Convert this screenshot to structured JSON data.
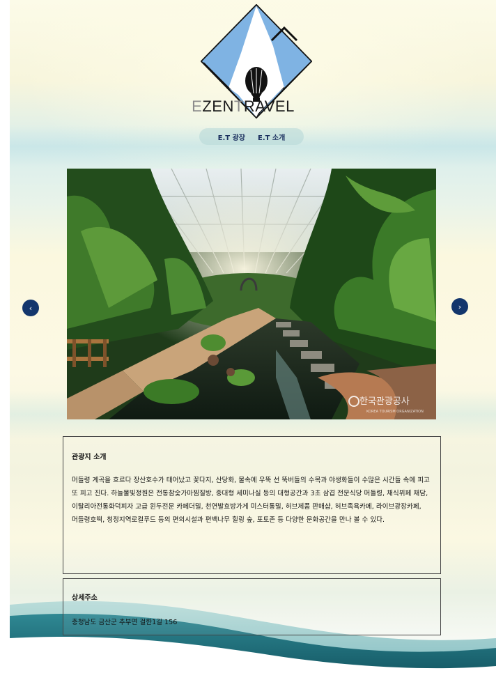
{
  "brand": {
    "first_letter": "E",
    "rest": "ZEN",
    "travel": "TRAVEL"
  },
  "nav": {
    "items": [
      "E.T 광장",
      "E.T 소개"
    ]
  },
  "slider": {
    "prev_glyph": "‹",
    "next_glyph": "›",
    "watermark": "한국관광공사",
    "watermark_sub": "KOREA TOURISM ORGANIZATION"
  },
  "intro": {
    "title": "관광지 소개",
    "body": "머들령 계곡을 흐르다 장산호수가 태어났고 꽃다지, 산당화, 물속에 우뚝 선 뚝버들의 수목과 야생화들이 수많은 시간들 속에 피고 또 피고 진다. 하늘물빛정원은 전통참숯가마찜질방, 중대형 세미나실 등의 대형공간과 3초 삼겹 전문식당 머들령, 채식뷔페 채담, 이탈리아전통화덕피자 고급 윈두전문 카페더밀, 천연발효방가게 미스터통밀, 허브제품 판매샵, 허브족욕카페, 라이브광장카페, 머들령호떡, 청정지역로컬푸드 등의 편의시설과 편백나무 힐링 숲, 포토존 등 다양한 문화공간을 만나 볼 수 있다."
  },
  "address": {
    "title": "상세주소",
    "value": "충청남도 금산군 추부면 걸한1길 156"
  },
  "colors": {
    "accent": "#13366c",
    "logo_blue": "#7fb3e3",
    "nav_text": "#1b2f5e",
    "wave": "#1f7480"
  }
}
